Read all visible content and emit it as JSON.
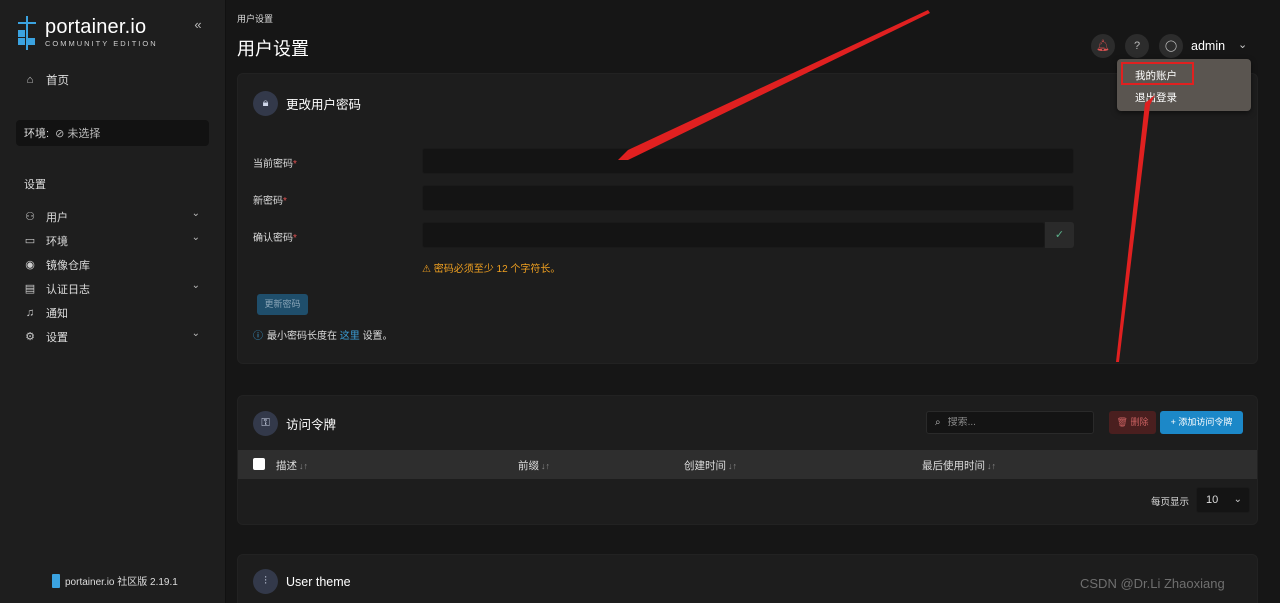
{
  "sidebar": {
    "logo_title": "portainer.io",
    "logo_subtitle": "COMMUNITY EDITION",
    "collapse_glyph": "«",
    "home_label": "首页",
    "env_label": "环境:",
    "env_value": "未选择",
    "settings_heading": "设置",
    "items": [
      {
        "label": "用户",
        "icon": "users-icon",
        "expandable": true
      },
      {
        "label": "环境",
        "icon": "hdd-icon",
        "expandable": true
      },
      {
        "label": "镜像仓库",
        "icon": "radio-icon",
        "expandable": false
      },
      {
        "label": "认证日志",
        "icon": "file-text-icon",
        "expandable": true
      },
      {
        "label": "通知",
        "icon": "bell-icon",
        "expandable": false
      },
      {
        "label": "设置",
        "icon": "gear-icon",
        "expandable": true
      }
    ],
    "version_text": "portainer.io 社区版 2.19.1"
  },
  "header": {
    "breadcrumb": "用户设置",
    "title": "用户设置",
    "username": "admin"
  },
  "dropdown": {
    "my_account": "我的账户",
    "logout": "退出登录"
  },
  "password_card": {
    "title": "更改用户密码",
    "current_label": "当前密码",
    "new_label": "新密码",
    "confirm_label": "确认密码",
    "required_mark": "*",
    "warning": "⚠ 密码必须至少 12 个字符长。",
    "update_button": "更新密码",
    "hint_prefix": "最小密码长度在",
    "hint_link": "这里",
    "hint_suffix": "设置。"
  },
  "tokens_card": {
    "title": "访问令牌",
    "search_placeholder": "搜索...",
    "delete_button": "删除",
    "add_button": "+ 添加访问令牌",
    "columns": [
      "描述",
      "前缀",
      "创建时间",
      "最后使用时间"
    ],
    "sort_glyph": "↓↑",
    "per_page_label": "每页显示",
    "per_page_value": "10"
  },
  "theme_card": {
    "title": "User theme"
  },
  "watermark": "CSDN @Dr.Li Zhaoxiang",
  "colors": {
    "accent": "#1c88c8",
    "danger": "#e05252",
    "warning": "#f0a020",
    "annotation": "#e02020"
  }
}
